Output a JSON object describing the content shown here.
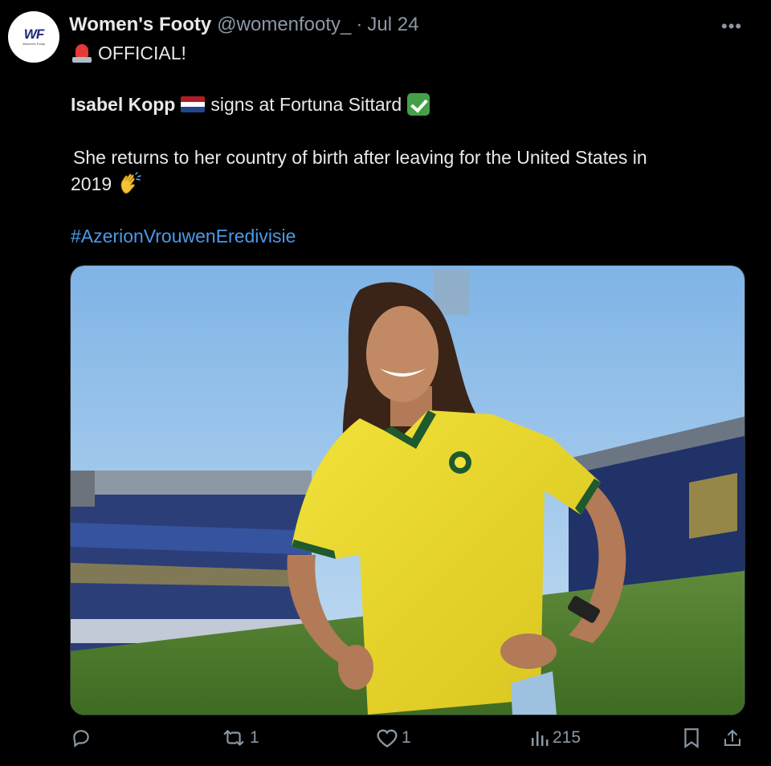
{
  "account": {
    "name": "Women's Footy",
    "handle": "@womenfooty_",
    "separator": "·",
    "date": "Jul 24",
    "avatar_text": "WF",
    "avatar_subtext": "Women's Footy"
  },
  "more_label": "•••",
  "tweet": {
    "line1": "OFFICIAL!",
    "player_name": "Isabel Kopp",
    "signs_text": "signs at Fortuna Sittard",
    "returns_text_line1": "She returns to her country of birth after leaving for the United States in",
    "returns_text_line2": "2019",
    "hashtag": "#AzerionVrouwenEredivisie"
  },
  "icons": {
    "siren": "police-light-icon",
    "flag": "netherlands-flag-icon",
    "check": "check-mark-button-icon",
    "wave": "waving-hand-icon"
  },
  "actions": {
    "reply_count": "",
    "retweet_count": "1",
    "like_count": "1",
    "views_count": "215"
  },
  "colors": {
    "background": "#000000",
    "text": "#e7e9ea",
    "secondary_text": "#8b98a5",
    "hashtag": "#4a9ae8"
  }
}
